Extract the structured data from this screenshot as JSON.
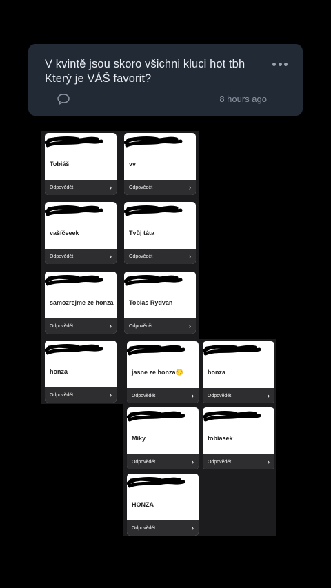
{
  "post": {
    "line1": "V kvintě jsou skoro všichni kluci hot tbh",
    "line2": "Který je VÁŠ favorit?",
    "timestamp": "8 hours ago"
  },
  "icons": {
    "more": "more-horizontal-icon",
    "comment": "comment-bubble-icon",
    "reply_chevron": "chevron-right-icon"
  },
  "reply_label": "Odpovědět",
  "reply_chevron": "›",
  "answers": [
    "Tobiáš",
    "vv",
    "vašíčeeek",
    "Tvůj táta",
    "samozrejme ze honza",
    "Tobias Rydvan",
    "honza",
    "jasne ze honza😏",
    "honza",
    "Miky",
    "tobiasek",
    "HONZA"
  ],
  "colors": {
    "background": "#000000",
    "post_bg": "#222a36",
    "card_bg": "#ffffff",
    "card_footer": "#2e2e30"
  }
}
